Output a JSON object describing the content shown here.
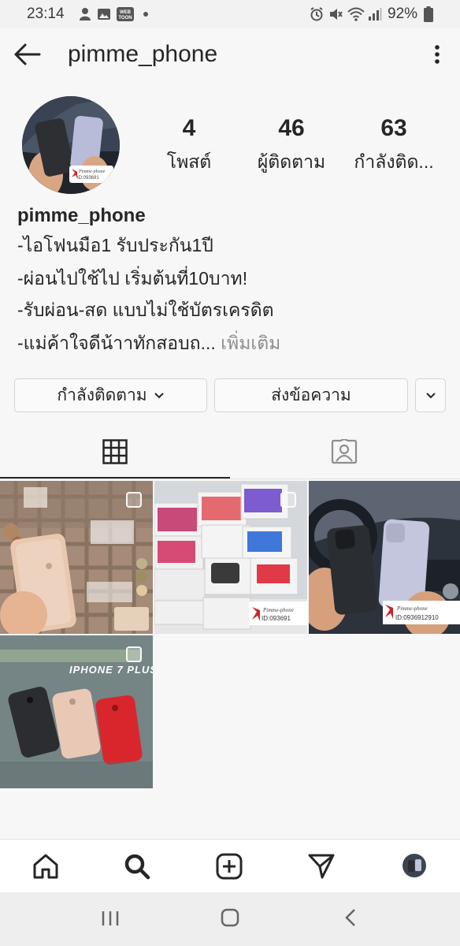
{
  "status_bar": {
    "time": "23:14",
    "battery": "92%",
    "icons": [
      "person-icon",
      "image-icon",
      "webtoon-icon",
      "dot-icon",
      "alarm-icon",
      "mute-icon",
      "wifi-icon",
      "signal-icon",
      "battery-icon"
    ],
    "webtoon_label": "WEB TOON"
  },
  "header": {
    "username": "pimme_phone"
  },
  "profile": {
    "stats": [
      {
        "value": "4",
        "label": "โพสต์"
      },
      {
        "value": "46",
        "label": "ผู้ติดตาม"
      },
      {
        "value": "63",
        "label": "กำลังติด..."
      }
    ],
    "avatar_watermark": "Pimme-phone ID:093691"
  },
  "bio": {
    "name": "pimme_phone",
    "lines": [
      "-ไอโฟนมือ1 รับประกัน1ปี",
      "-ผ่อนไปใช้ไป เริ่มต้นที่10บาท!",
      "-รับผ่อน-สด แบบไม่ใช้บัตรเครดิต",
      "-แม่ค้าใจดีน้าาทักสอบถ..."
    ],
    "more": "เพิ่มเติม"
  },
  "actions": {
    "following_label": "กำลังติดตาม",
    "message_label": "ส่งข้อความ"
  },
  "posts": {
    "post3_watermark": "Pimme-phone ID:0936912910",
    "post2_watermark": "Pimme-phone ID:093691",
    "post4_title": "IPHONE 7 PLUS"
  },
  "colors": {
    "accent": "#262626",
    "muted": "#8e8e8e",
    "red_phone": "#d8262c",
    "gold_phone": "#e9c7ae"
  }
}
